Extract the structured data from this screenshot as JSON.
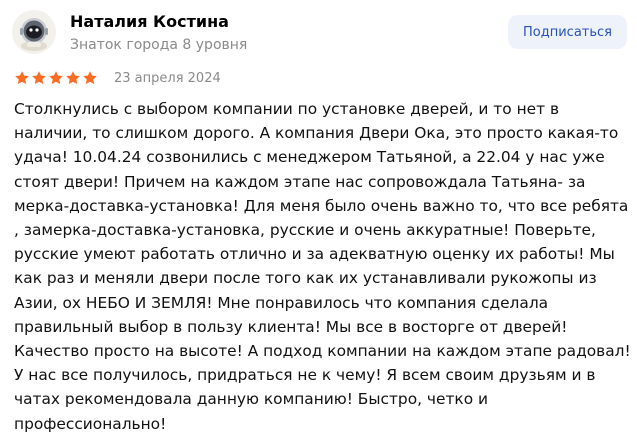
{
  "author": {
    "name": "Наталия Костина",
    "level": "Знаток города 8 уровня"
  },
  "subscribe_label": "Подписаться",
  "review": {
    "rating": 5,
    "rating_max": 5,
    "date": "23 апреля 2024",
    "lines": [
      "Столкнулись с выбором компании по установке дверей, и то нет в",
      "наличии, то слишком дорого. А компания Двери Ока, это просто какая-то",
      "удача! 10.04.24 созвонились с менеджером Татьяной, а 22.04 у нас уже",
      "стоят двери! Причем на каждом этапе нас сопровождала Татьяна- за",
      "мерка-доставка-установка! Для меня было очень важно то, что все ребята",
      ", замерка-доставка-установка, русские и очень аккуратные! Поверьте,",
      "русские умеют работать отлично и за адекватную оценку их работы! Мы",
      "как раз и меняли двери после того как их устанавливали рукожопы из",
      "Азии, ох НЕБО И ЗЕМЛЯ! Мне понравилось что компания сделала",
      "правильный выбор в пользу клиента! Мы все в восторге от дверей!",
      "Качество просто на высоте! А подход компании на каждом этапе радовал!",
      "У нас все получилось, придраться не к чему! Я всем своим друзьям и в",
      "чатах рекомендовала данную компанию! Быстро, четко и",
      "профессионально!"
    ]
  },
  "colors": {
    "star": "#fc6c22",
    "subscribe_bg": "#eef2fa",
    "subscribe_text": "#2752b8",
    "muted": "#8a8a8a"
  },
  "icons": {
    "avatar": "avatar-astronaut-icon",
    "star": "star-icon"
  }
}
